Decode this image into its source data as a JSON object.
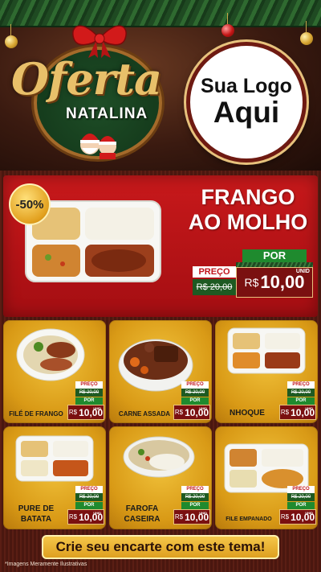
{
  "header": {
    "title_script": "Oferta",
    "title_sub": "NATALINA",
    "logo_line1": "Sua Logo",
    "logo_line2": "Aqui"
  },
  "featured": {
    "badge": "-50%",
    "title_line1": "FRANGO",
    "title_line2": "AO MOLHO",
    "preco_label": "PREÇO",
    "por_label": "POR",
    "old_price": "R$ 20,00",
    "new_currency": "R$",
    "new_price": "10,00",
    "unit": "UNID"
  },
  "products": [
    {
      "name": "FILÉ DE FRANGO",
      "preco_label": "PREÇO",
      "por_label": "POR",
      "old_price": "R$ 20,00",
      "new_currency": "R$",
      "new_price": "10,00",
      "unit": "UNID"
    },
    {
      "name": "CARNE ASSADA",
      "preco_label": "PREÇO",
      "por_label": "POR",
      "old_price": "R$ 20,00",
      "new_currency": "R$",
      "new_price": "10,00",
      "unit": "UNID"
    },
    {
      "name": "NHOQUE",
      "preco_label": "PREÇO",
      "por_label": "POR",
      "old_price": "R$ 20,00",
      "new_currency": "R$",
      "new_price": "10,00",
      "unit": "UNID"
    },
    {
      "name_line1": "PURE DE",
      "name_line2": "BATATA",
      "preco_label": "PREÇO",
      "por_label": "POR",
      "old_price": "R$ 20,00",
      "new_currency": "R$",
      "new_price": "10,00",
      "unit": "UNID"
    },
    {
      "name_line1": "FAROFA",
      "name_line2": "CASEIRA",
      "preco_label": "PREÇO",
      "por_label": "POR",
      "old_price": "R$ 20,00",
      "new_currency": "R$",
      "new_price": "10,00",
      "unit": "UNID"
    },
    {
      "name": "FILE EMPANADO",
      "preco_label": "PREÇO",
      "por_label": "POR",
      "old_price": "R$ 20,00",
      "new_currency": "R$",
      "new_price": "10,00",
      "unit": "UNID"
    }
  ],
  "cta": "Crie seu encarte com este tema!",
  "disclaimer": "*Imagens Meramente Ilustrativas",
  "colors": {
    "featured_red": "#c8191b",
    "card_gold": "#e0a520",
    "price_green": "#1f8a2e",
    "price_dark_red": "#7a1010",
    "title_gold": "#e8c06a"
  }
}
